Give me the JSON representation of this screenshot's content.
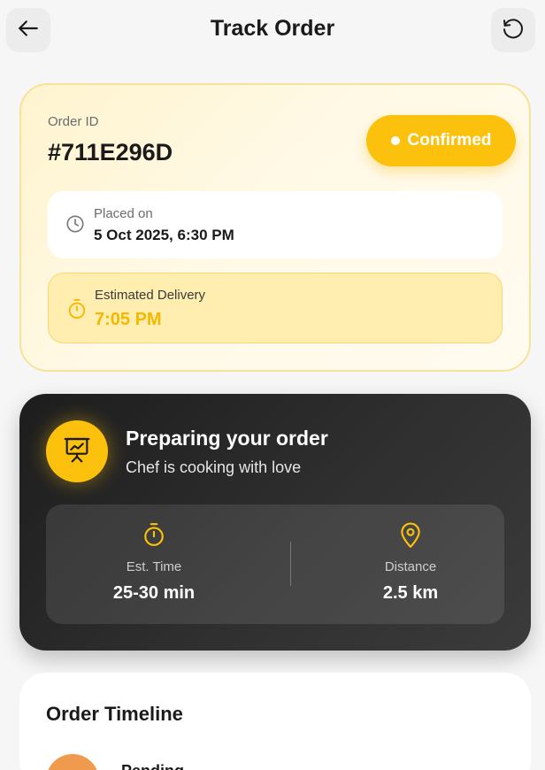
{
  "header": {
    "title": "Track Order",
    "back_icon": "arrow-left-icon",
    "refresh_icon": "refresh-icon"
  },
  "order": {
    "id_label": "Order ID",
    "id_value": "#711E296D",
    "status": "Confirmed",
    "placed_label": "Placed on",
    "placed_value": "5 Oct 2025, 6:30 PM",
    "estimated_label": "Estimated Delivery",
    "estimated_value": "7:05 PM"
  },
  "status_card": {
    "icon": "presentation-chart-icon",
    "title": "Preparing your order",
    "subtitle": "Chef is cooking with love",
    "metrics": [
      {
        "icon": "timer-icon",
        "label": "Est. Time",
        "value": "25-30 min"
      },
      {
        "icon": "map-pin-icon",
        "label": "Distance",
        "value": "2.5 km"
      }
    ]
  },
  "timeline": {
    "title": "Order Timeline",
    "steps": [
      {
        "label": "Pending"
      }
    ]
  },
  "colors": {
    "accent": "#fcc10d",
    "estimated_text": "#f5b800",
    "dark_card": "#2a2a2a",
    "pending_dot": "#ef9a4c",
    "background": "#f6f6f6"
  }
}
